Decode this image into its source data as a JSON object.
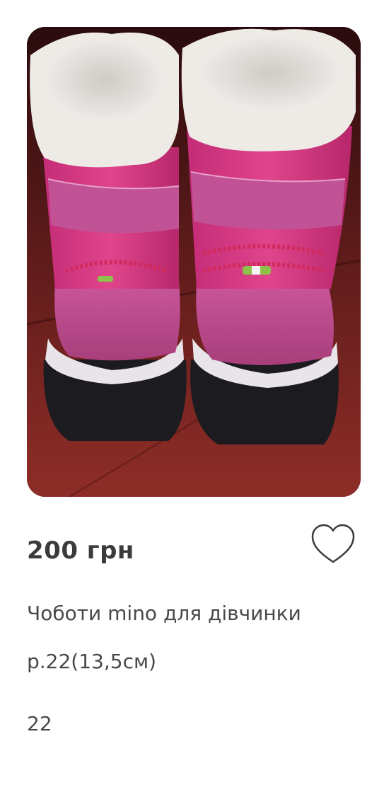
{
  "listing": {
    "price": "200 грн",
    "title": "Чоботи mino для дівчинки",
    "subtitle": "р.22(13,5см)",
    "size": "22",
    "favorite_icon": "heart-outline-icon"
  },
  "colors": {
    "boot_pink": "#d9357f",
    "boot_suede": "#c8508d",
    "sole": "#1c1b1f",
    "fur": "#e6e3df",
    "floor": "#8a2a24",
    "text": "#3b3b3b"
  }
}
